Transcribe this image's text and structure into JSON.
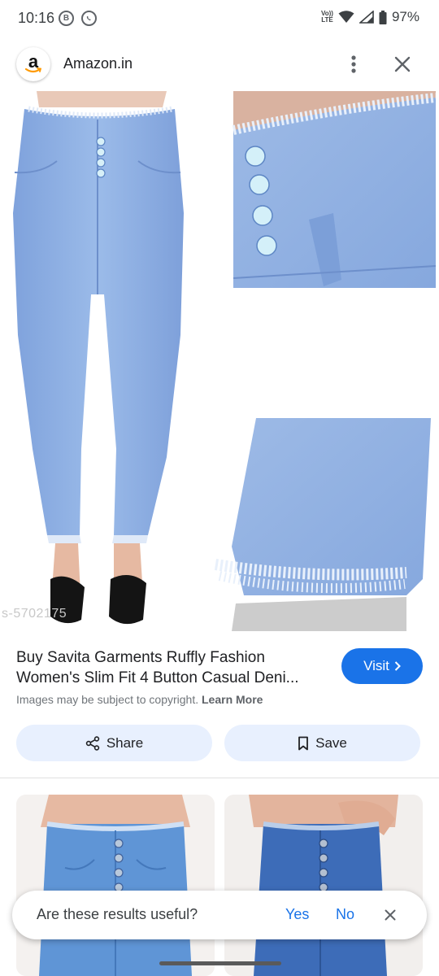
{
  "status_bar": {
    "time": "10:16",
    "app_icon_letter": "B",
    "battery": "97%",
    "volte_label": "Vo)) LTE"
  },
  "header": {
    "site_logo_letter": "a",
    "site_name": "Amazon.in",
    "icons": [
      "more-vert-icon",
      "close-icon"
    ]
  },
  "main_image": {
    "watermark": "s-5702175"
  },
  "result": {
    "title_line1": "Buy Savita Garments Ruffly Fashion",
    "title_line2": "Women's Slim Fit 4 Button Casual Deni...",
    "visit_label": "Visit",
    "copyright_text": "Images may be subject to copyright.",
    "learn_more": "Learn More"
  },
  "actions": {
    "share_label": "Share",
    "save_label": "Save"
  },
  "feedback": {
    "question": "Are these results useful?",
    "yes": "Yes",
    "no": "No"
  },
  "colors": {
    "accent": "#1a73e8",
    "button_bg": "#e8f0fe",
    "denim_light": "#8fb0e4",
    "denim_dark": "#4f78bf"
  }
}
